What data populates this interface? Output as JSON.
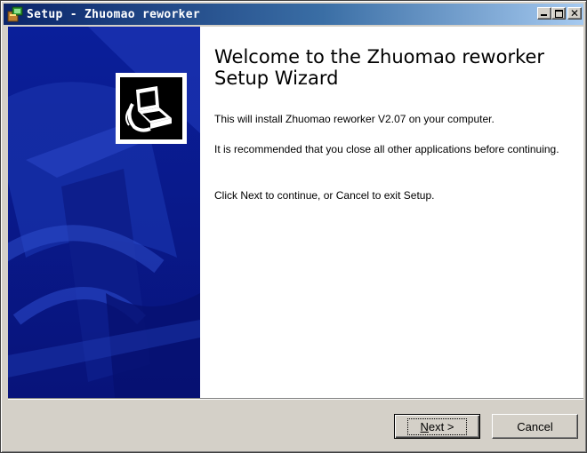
{
  "window": {
    "title": "Setup - Zhuomao reworker",
    "controls": {
      "minimize_icon": "minimize-icon",
      "maximize_icon": "maximize-icon",
      "close_icon": "close-icon"
    }
  },
  "side_panel": {
    "color": "#0b1a8f",
    "logo_icon": "computer-setup-icon"
  },
  "content": {
    "heading": "Welcome to the Zhuomao reworker Setup Wizard",
    "paragraphs": [
      "This will install Zhuomao reworker V2.07 on your computer.",
      "It is recommended that you close all other applications before continuing.",
      "Click Next to continue, or Cancel to exit Setup."
    ]
  },
  "buttons": {
    "next_mnemonic": "N",
    "next_rest": "ext >",
    "cancel": "Cancel"
  },
  "colors": {
    "title_active": "#0a246a",
    "face": "#d4d0c8"
  }
}
